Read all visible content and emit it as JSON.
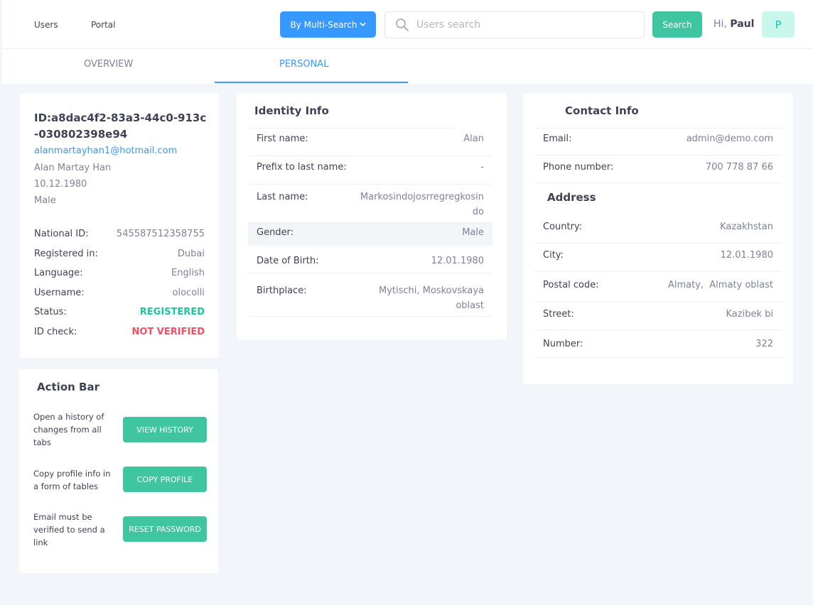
{
  "nav": {
    "links": [
      "Users",
      "Portal"
    ],
    "multi_search_label": "By Multi-Search",
    "search_placeholder": "Users search",
    "search_button": "Search",
    "greeting_prefix": "Hi,",
    "user_name": "Paul",
    "avatar_letter": "P"
  },
  "tabs": [
    "OVERVIEW",
    "PERSONAL"
  ],
  "profile": {
    "id": "ID:a8dac4f2-83a3-44c0-913c-030802398e94",
    "email": "alanmartayhan1@hotmail.com",
    "full_name": "Alan Martay Han",
    "dob": "10.12.1980",
    "gender": "Male",
    "details": [
      {
        "label": "National ID:",
        "value": "545587512358755"
      },
      {
        "label": "Registered in:",
        "value": "Dubai"
      },
      {
        "label": "Language:",
        "value": "English"
      },
      {
        "label": "Username:",
        "value": "olocolli"
      },
      {
        "label": "Status:",
        "value": "REGISTERED"
      },
      {
        "label": "ID check:",
        "value": "NOT VERIFIED"
      }
    ]
  },
  "action_bar": {
    "title": "Action Bar",
    "actions": [
      {
        "desc": "Open a history of changes from all tabs",
        "button": "VIEW HISTORY"
      },
      {
        "desc": "Copy profile info in a form of tables",
        "button": "COPY PROFILE"
      },
      {
        "desc": "Email must be verified to send a link",
        "button": "RESET PASSWORD"
      }
    ]
  },
  "identity": {
    "title": "Identity Info",
    "rows": [
      {
        "label": "First name:",
        "value": "Alan"
      },
      {
        "label": "Prefix to last name:",
        "value": "-"
      },
      {
        "label": "Last name:",
        "value": "Markosindojosrregregkosindo"
      },
      {
        "label": "Gender:",
        "value": "Male"
      },
      {
        "label": "Date of Birth:",
        "value": "12.01.1980"
      },
      {
        "label": "Birthplace:",
        "value": "Mytischi, Moskovskaya oblast"
      }
    ]
  },
  "contact": {
    "title": "Contact Info",
    "rows": [
      {
        "label": "Email:",
        "value": "admin@demo.com"
      },
      {
        "label": "Phone number:",
        "value": "700 778 87 66"
      }
    ],
    "address_title": "Address",
    "address_rows": [
      {
        "label": "Country:",
        "value": "Kazakhstan"
      },
      {
        "label": "City:",
        "value": "12.01.1980"
      },
      {
        "label": "Postal code:",
        "value": "Almaty,  Almaty oblast"
      },
      {
        "label": "Street:",
        "value": "Kazibek bi"
      },
      {
        "label": "Number:",
        "value": "322"
      }
    ]
  },
  "colors": {
    "primary": "#3699ff",
    "accent": "#3fc5a0",
    "status_registered": "#1bc5a0",
    "status_not_verified": "#f64e60"
  }
}
